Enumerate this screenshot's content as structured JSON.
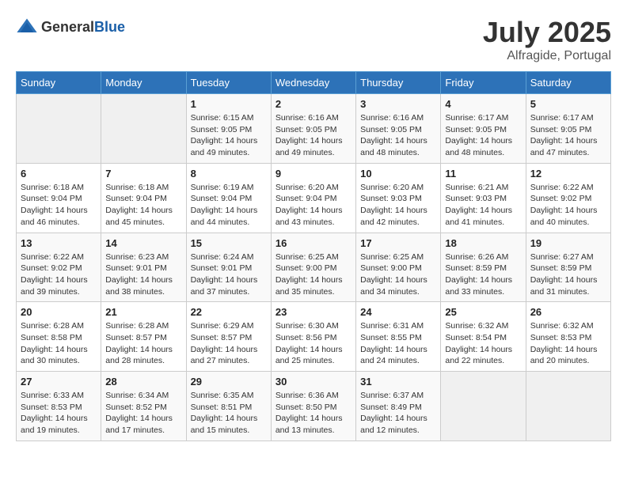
{
  "header": {
    "logo_general": "General",
    "logo_blue": "Blue",
    "month_year": "July 2025",
    "location": "Alfragide, Portugal"
  },
  "days_of_week": [
    "Sunday",
    "Monday",
    "Tuesday",
    "Wednesday",
    "Thursday",
    "Friday",
    "Saturday"
  ],
  "weeks": [
    [
      {
        "num": "",
        "sunrise": "",
        "sunset": "",
        "daylight": ""
      },
      {
        "num": "",
        "sunrise": "",
        "sunset": "",
        "daylight": ""
      },
      {
        "num": "1",
        "sunrise": "Sunrise: 6:15 AM",
        "sunset": "Sunset: 9:05 PM",
        "daylight": "Daylight: 14 hours and 49 minutes."
      },
      {
        "num": "2",
        "sunrise": "Sunrise: 6:16 AM",
        "sunset": "Sunset: 9:05 PM",
        "daylight": "Daylight: 14 hours and 49 minutes."
      },
      {
        "num": "3",
        "sunrise": "Sunrise: 6:16 AM",
        "sunset": "Sunset: 9:05 PM",
        "daylight": "Daylight: 14 hours and 48 minutes."
      },
      {
        "num": "4",
        "sunrise": "Sunrise: 6:17 AM",
        "sunset": "Sunset: 9:05 PM",
        "daylight": "Daylight: 14 hours and 48 minutes."
      },
      {
        "num": "5",
        "sunrise": "Sunrise: 6:17 AM",
        "sunset": "Sunset: 9:05 PM",
        "daylight": "Daylight: 14 hours and 47 minutes."
      }
    ],
    [
      {
        "num": "6",
        "sunrise": "Sunrise: 6:18 AM",
        "sunset": "Sunset: 9:04 PM",
        "daylight": "Daylight: 14 hours and 46 minutes."
      },
      {
        "num": "7",
        "sunrise": "Sunrise: 6:18 AM",
        "sunset": "Sunset: 9:04 PM",
        "daylight": "Daylight: 14 hours and 45 minutes."
      },
      {
        "num": "8",
        "sunrise": "Sunrise: 6:19 AM",
        "sunset": "Sunset: 9:04 PM",
        "daylight": "Daylight: 14 hours and 44 minutes."
      },
      {
        "num": "9",
        "sunrise": "Sunrise: 6:20 AM",
        "sunset": "Sunset: 9:04 PM",
        "daylight": "Daylight: 14 hours and 43 minutes."
      },
      {
        "num": "10",
        "sunrise": "Sunrise: 6:20 AM",
        "sunset": "Sunset: 9:03 PM",
        "daylight": "Daylight: 14 hours and 42 minutes."
      },
      {
        "num": "11",
        "sunrise": "Sunrise: 6:21 AM",
        "sunset": "Sunset: 9:03 PM",
        "daylight": "Daylight: 14 hours and 41 minutes."
      },
      {
        "num": "12",
        "sunrise": "Sunrise: 6:22 AM",
        "sunset": "Sunset: 9:02 PM",
        "daylight": "Daylight: 14 hours and 40 minutes."
      }
    ],
    [
      {
        "num": "13",
        "sunrise": "Sunrise: 6:22 AM",
        "sunset": "Sunset: 9:02 PM",
        "daylight": "Daylight: 14 hours and 39 minutes."
      },
      {
        "num": "14",
        "sunrise": "Sunrise: 6:23 AM",
        "sunset": "Sunset: 9:01 PM",
        "daylight": "Daylight: 14 hours and 38 minutes."
      },
      {
        "num": "15",
        "sunrise": "Sunrise: 6:24 AM",
        "sunset": "Sunset: 9:01 PM",
        "daylight": "Daylight: 14 hours and 37 minutes."
      },
      {
        "num": "16",
        "sunrise": "Sunrise: 6:25 AM",
        "sunset": "Sunset: 9:00 PM",
        "daylight": "Daylight: 14 hours and 35 minutes."
      },
      {
        "num": "17",
        "sunrise": "Sunrise: 6:25 AM",
        "sunset": "Sunset: 9:00 PM",
        "daylight": "Daylight: 14 hours and 34 minutes."
      },
      {
        "num": "18",
        "sunrise": "Sunrise: 6:26 AM",
        "sunset": "Sunset: 8:59 PM",
        "daylight": "Daylight: 14 hours and 33 minutes."
      },
      {
        "num": "19",
        "sunrise": "Sunrise: 6:27 AM",
        "sunset": "Sunset: 8:59 PM",
        "daylight": "Daylight: 14 hours and 31 minutes."
      }
    ],
    [
      {
        "num": "20",
        "sunrise": "Sunrise: 6:28 AM",
        "sunset": "Sunset: 8:58 PM",
        "daylight": "Daylight: 14 hours and 30 minutes."
      },
      {
        "num": "21",
        "sunrise": "Sunrise: 6:28 AM",
        "sunset": "Sunset: 8:57 PM",
        "daylight": "Daylight: 14 hours and 28 minutes."
      },
      {
        "num": "22",
        "sunrise": "Sunrise: 6:29 AM",
        "sunset": "Sunset: 8:57 PM",
        "daylight": "Daylight: 14 hours and 27 minutes."
      },
      {
        "num": "23",
        "sunrise": "Sunrise: 6:30 AM",
        "sunset": "Sunset: 8:56 PM",
        "daylight": "Daylight: 14 hours and 25 minutes."
      },
      {
        "num": "24",
        "sunrise": "Sunrise: 6:31 AM",
        "sunset": "Sunset: 8:55 PM",
        "daylight": "Daylight: 14 hours and 24 minutes."
      },
      {
        "num": "25",
        "sunrise": "Sunrise: 6:32 AM",
        "sunset": "Sunset: 8:54 PM",
        "daylight": "Daylight: 14 hours and 22 minutes."
      },
      {
        "num": "26",
        "sunrise": "Sunrise: 6:32 AM",
        "sunset": "Sunset: 8:53 PM",
        "daylight": "Daylight: 14 hours and 20 minutes."
      }
    ],
    [
      {
        "num": "27",
        "sunrise": "Sunrise: 6:33 AM",
        "sunset": "Sunset: 8:53 PM",
        "daylight": "Daylight: 14 hours and 19 minutes."
      },
      {
        "num": "28",
        "sunrise": "Sunrise: 6:34 AM",
        "sunset": "Sunset: 8:52 PM",
        "daylight": "Daylight: 14 hours and 17 minutes."
      },
      {
        "num": "29",
        "sunrise": "Sunrise: 6:35 AM",
        "sunset": "Sunset: 8:51 PM",
        "daylight": "Daylight: 14 hours and 15 minutes."
      },
      {
        "num": "30",
        "sunrise": "Sunrise: 6:36 AM",
        "sunset": "Sunset: 8:50 PM",
        "daylight": "Daylight: 14 hours and 13 minutes."
      },
      {
        "num": "31",
        "sunrise": "Sunrise: 6:37 AM",
        "sunset": "Sunset: 8:49 PM",
        "daylight": "Daylight: 14 hours and 12 minutes."
      },
      {
        "num": "",
        "sunrise": "",
        "sunset": "",
        "daylight": ""
      },
      {
        "num": "",
        "sunrise": "",
        "sunset": "",
        "daylight": ""
      }
    ]
  ]
}
